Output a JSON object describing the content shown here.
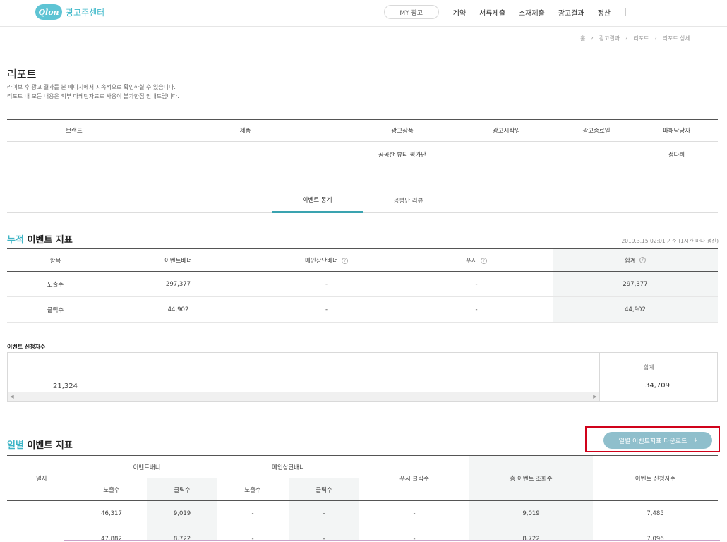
{
  "header": {
    "logo_text": "Qlon",
    "site_name": "광고주센터",
    "my_ad": "MY 광고",
    "nav": [
      "계약",
      "서류제출",
      "소재제출",
      "광고결과",
      "정산"
    ]
  },
  "breadcrumb": [
    "홈",
    "›",
    "광고결과",
    "›",
    "리포트",
    "›",
    "리포트 상세"
  ],
  "page": {
    "title": "리포트",
    "desc1": "라이브 후 광고 결과를 본 페이지에서 지속적으로 확인하실 수 있습니다.",
    "desc2": "리포트 내 모든 내용은 외부 마케팅자료로 사용이 불가한점 안내드립니다."
  },
  "info": {
    "headers": [
      "브랜드",
      "제품",
      "광고상품",
      "광고시작일",
      "광고종료일",
      "파해담당자"
    ],
    "values": [
      "",
      "",
      "공공한 뷰티 평가단",
      "",
      "",
      "정다희"
    ]
  },
  "tabs": {
    "active": "이벤트 통계",
    "other": "공평단 리뷰"
  },
  "cumulative": {
    "title_accent": "누적",
    "title_rest": " 이벤트 지표",
    "note": "2019.3.15 02:01 기준 (1시간 마다 갱신)",
    "headers": [
      "항목",
      "이벤트배너",
      "메인상단배너",
      "푸시",
      "합계"
    ],
    "help": "?",
    "rows": [
      [
        "노출수",
        "297,377",
        "-",
        "-",
        "297,377"
      ],
      [
        "클릭수",
        "44,902",
        "-",
        "-",
        "44,902"
      ]
    ]
  },
  "applicants": {
    "label": "이벤트 신청자수",
    "value": "21,324",
    "total_label": "합계",
    "total_value": "34,709",
    "scroll_left": "◀",
    "scroll_right": "▶"
  },
  "daily": {
    "title_accent": "일별",
    "title_rest": " 이벤트 지표",
    "download": "일별 이벤트지표 다운로드",
    "download_icon": "⤓",
    "h_date": "일자",
    "h_event_banner": "이벤트배너",
    "h_main_banner": "메인상단배너",
    "h_push": "푸시 클릭수",
    "h_total": "총 이벤트 조회수",
    "h_applicants": "이벤트 신청자수",
    "h_impr": "노출수",
    "h_click": "클릭수",
    "rows": [
      [
        "",
        "46,317",
        "9,019",
        "-",
        "-",
        "-",
        "9,019",
        "7,485"
      ],
      [
        "",
        "47,882",
        "8,722",
        "-",
        "-",
        "-",
        "8,722",
        "7,096"
      ]
    ]
  }
}
